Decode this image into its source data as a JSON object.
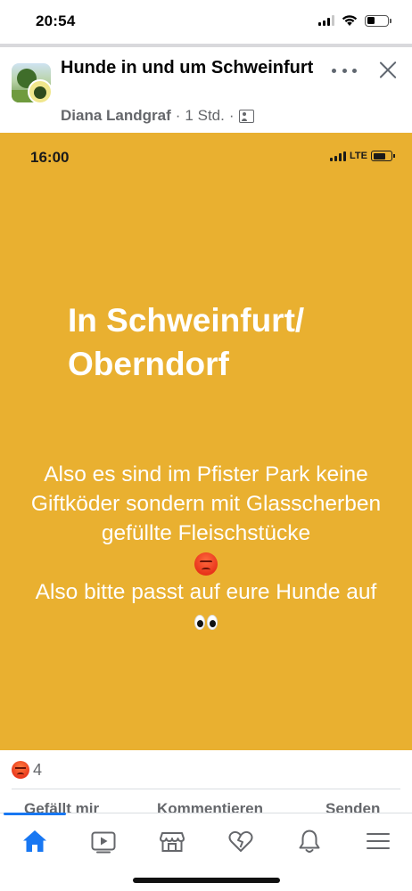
{
  "status_bar": {
    "time": "20:54"
  },
  "post": {
    "group_title": "Hunde in und um Schweinfurt",
    "author": "Diana Landgraf",
    "separator": "·",
    "time_ago": "1 Std.",
    "icons": {
      "avatar": "group-avatar",
      "more": "more-dots-icon",
      "close": "close-icon",
      "audience": "group-audience-icon"
    }
  },
  "story": {
    "time": "16:00",
    "network": "LTE",
    "headline": "In Schweinfurt/ Oberndorf",
    "body_line1": "Also es sind im Pfister Park keine Giftköder sondern mit Glasscherben  gefüllte Fleischstücke",
    "body_line2": "Also bitte passt auf eure Hunde auf",
    "background_color": "#e9b030"
  },
  "reactions": {
    "type": "angry",
    "count": "4"
  },
  "actions": {
    "like": "Gefällt mir",
    "comment": "Kommentieren",
    "send": "Senden"
  },
  "tab_bar": {
    "active_color": "#1877f2",
    "tabs": [
      {
        "icon": "home-icon",
        "active": true
      },
      {
        "icon": "video-icon",
        "active": false
      },
      {
        "icon": "marketplace-icon",
        "active": false
      },
      {
        "icon": "dating-heart-icon",
        "active": false
      },
      {
        "icon": "bell-icon",
        "active": false
      },
      {
        "icon": "menu-icon",
        "active": false
      }
    ]
  }
}
